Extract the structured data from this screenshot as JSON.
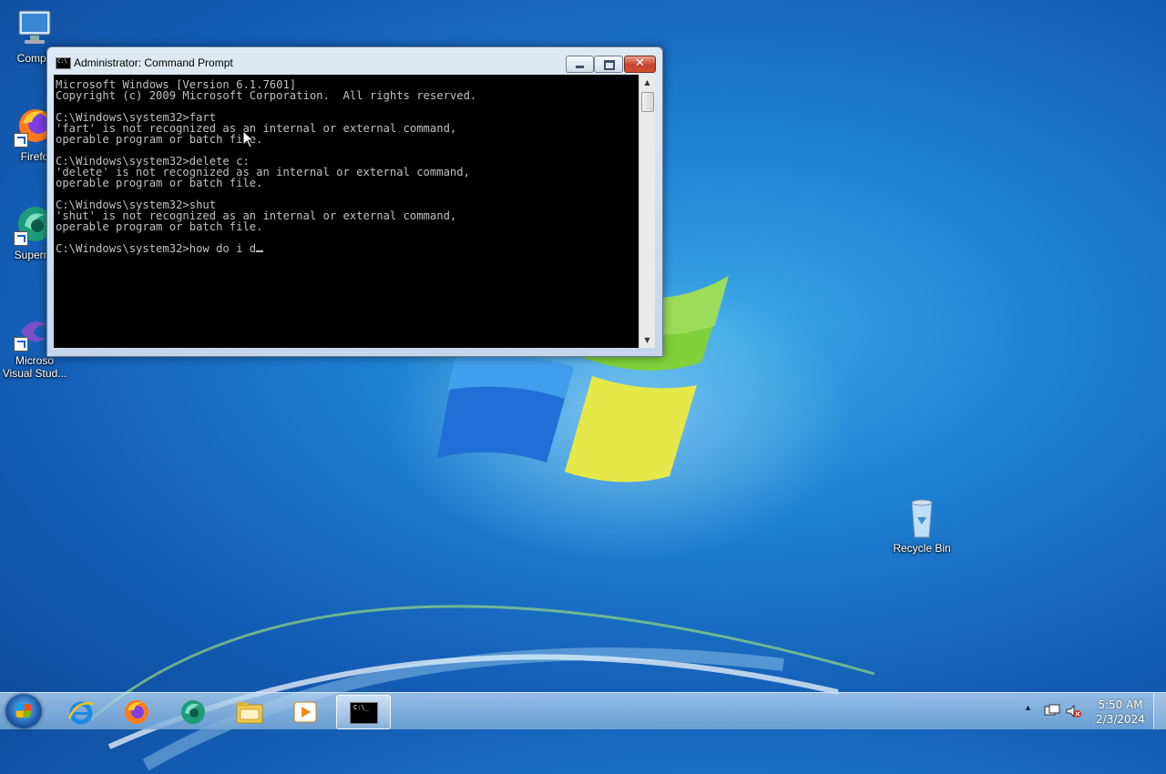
{
  "desktop": {
    "icons": [
      {
        "label": "Compu",
        "icon": "computer-icon"
      },
      {
        "label": "Firefo",
        "icon": "firefox-icon"
      },
      {
        "label": "Supermi",
        "icon": "supermium-icon"
      },
      {
        "label": "Microso",
        "label2": "Visual Stud...",
        "icon": "visual-studio-icon"
      },
      {
        "label": "Recycle Bin",
        "icon": "recycle-bin-icon"
      }
    ]
  },
  "window": {
    "title": "Administrator:  Command Prompt",
    "close_glyph": "✕",
    "lines": [
      "Microsoft Windows [Version 6.1.7601]",
      "Copyright (c) 2009 Microsoft Corporation.  All rights reserved.",
      "",
      "C:\\Windows\\system32>fart",
      "'fart' is not recognized as an internal or external command,",
      "operable program or batch file.",
      "",
      "C:\\Windows\\system32>delete c:",
      "'delete' is not recognized as an internal or external command,",
      "operable program or batch file.",
      "",
      "C:\\Windows\\system32>shut",
      "'shut' is not recognized as an internal or external command,",
      "operable program or batch file.",
      "",
      "C:\\Windows\\system32>how do i d"
    ]
  },
  "taskbar": {
    "items": [
      {
        "name": "internet-explorer",
        "icon": "ie-icon"
      },
      {
        "name": "firefox",
        "icon": "firefox-icon"
      },
      {
        "name": "supermium",
        "icon": "supermium-icon"
      },
      {
        "name": "file-explorer",
        "icon": "folder-icon"
      },
      {
        "name": "media-player",
        "icon": "media-player-icon"
      },
      {
        "name": "command-prompt",
        "icon": "cmd-icon",
        "active": true
      }
    ],
    "cmd_glyph": "C:\\_",
    "tray_arrow": "▲",
    "time": "5:50 AM",
    "date": "2/3/2024"
  }
}
